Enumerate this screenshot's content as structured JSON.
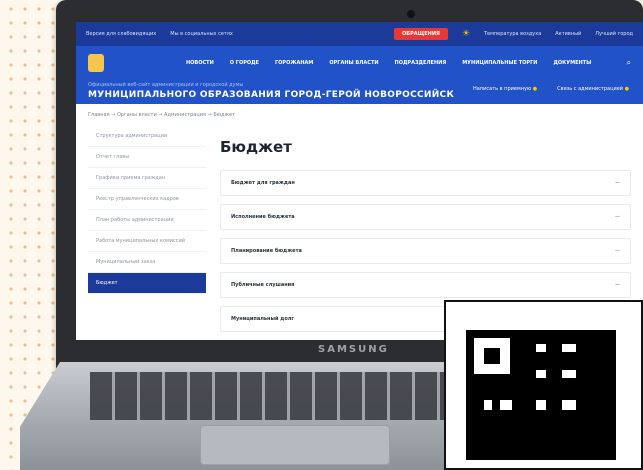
{
  "device": {
    "brand": "SAMSUNG"
  },
  "topbar": {
    "left_link": "Версия для слабовидящих",
    "social_label": "Мы в социальных сетях",
    "button": "ОБРАЩЕНИЯ",
    "weather1": "Температура воздуха",
    "weather2": "Активный ",
    "weather3": "Лучший город"
  },
  "header": {
    "nav": [
      "НОВОСТИ",
      "О ГОРОДЕ",
      "ГОРОЖАНАМ",
      "ОРГАНЫ ВЛАСТИ",
      "ПОДРАЗДЕЛЕНИЯ",
      "МУНИЦИПАЛЬНЫЕ ТОРГИ",
      "ДОКУМЕНТЫ"
    ],
    "subtitle": "Официальный веб-сайт администрации и городской думы",
    "title": "МУНИЦИПАЛЬНОГО ОБРАЗОВАНИЯ ГОРОД-ГЕРОЙ НОВОРОССИЙСК",
    "links": [
      "Написать в приемную",
      "Связь с администрацией"
    ]
  },
  "breadcrumb": "Главная → Органы власти → Администрация → Бюджет",
  "sidebar": [
    "Структура администрации",
    "Отчет главы",
    "Графики приема граждан",
    "Реестр управленческих кадров",
    "План работы администрации",
    "Работа муниципальных комиссий",
    "Муниципальный заказ",
    "Бюджет"
  ],
  "page_title": "Бюджет",
  "accordion": [
    "Бюджет для граждан",
    "Исполнение бюджета",
    "Планирование бюджета",
    "Публичные слушания",
    "Муниципальный долг"
  ]
}
